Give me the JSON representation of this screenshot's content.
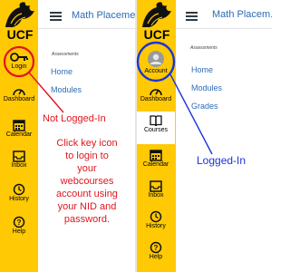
{
  "left_panel": {
    "logo_text": "UCF",
    "course_title": "Math Placemen",
    "section_label": "Assessments",
    "menu": [
      "Home",
      "Modules"
    ],
    "nav": {
      "login": "Login",
      "dashboard": "Dashboard",
      "calendar": "Calendar",
      "inbox": "Inbox",
      "history": "History",
      "help": "Help"
    },
    "annotation_status": "Not Logged-In",
    "annotation_instructions": [
      "Click key icon",
      "to login to",
      "your",
      "webcourses",
      "account using",
      "your NID and",
      "password."
    ]
  },
  "right_panel": {
    "logo_text": "UCF",
    "course_title": "Math Placem...",
    "section_label": "Assessments",
    "menu": [
      "Home",
      "Modules",
      "Grades"
    ],
    "nav": {
      "account": "Account",
      "dashboard": "Dashboard",
      "courses": "Courses",
      "calendar": "Calendar",
      "inbox": "Inbox",
      "history": "History",
      "help": "Help"
    },
    "annotation_status": "Logged-In"
  },
  "colors": {
    "rail": "#ffc904",
    "link": "#2d6cb4",
    "annotation_red": "#e0161e",
    "annotation_blue": "#1b34d8"
  }
}
